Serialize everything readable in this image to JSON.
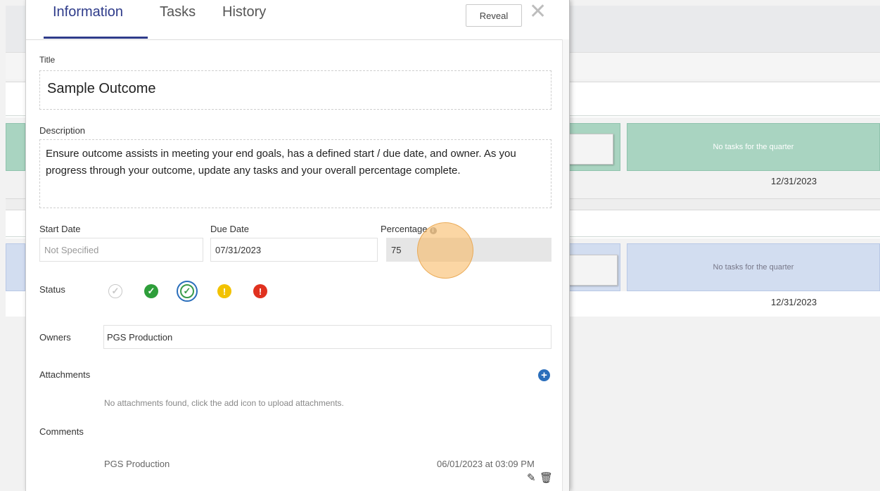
{
  "tabs": [
    {
      "label": "Information",
      "active": true
    },
    {
      "label": "Tasks",
      "active": false
    },
    {
      "label": "History",
      "active": false
    }
  ],
  "reveal_label": "Reveal",
  "title": {
    "label": "Title",
    "value": "Sample Outcome"
  },
  "description": {
    "label": "Description",
    "value": "Ensure outcome assists in meeting your end goals, has a defined start / due date, and owner. As you progress through your outcome, update any tasks and your overall percentage complete."
  },
  "start_date": {
    "label": "Start Date",
    "placeholder": "Not Specified"
  },
  "due_date": {
    "label": "Due Date",
    "value": "07/31/2023"
  },
  "percentage": {
    "label": "Percentage",
    "value": "75"
  },
  "status": {
    "label": "Status",
    "options": [
      "not-started",
      "on-track",
      "complete",
      "at-risk",
      "off-track"
    ],
    "selected": "complete",
    "colors": {
      "not-started": "#c8c8c8",
      "on-track": "#2e9e3a",
      "complete": "#3a9a4a",
      "at-risk": "#f2c200",
      "off-track": "#e0311f"
    }
  },
  "owners": {
    "label": "Owners",
    "value": "PGS Production"
  },
  "attachments": {
    "label": "Attachments",
    "empty_text": "No attachments found, click the add icon to upload attachments."
  },
  "comments": {
    "label": "Comments",
    "items": [
      {
        "author": "PGS Production",
        "timestamp": "06/01/2023 at 03:09 PM"
      }
    ]
  },
  "background": {
    "rows": [
      {
        "cell_text": "No tasks for the quarter",
        "date": "12/31/2023",
        "color": "#a9d4c1"
      },
      {
        "cell_text": "No tasks for the quarter",
        "date": "12/31/2023",
        "color": "#d2ddf0"
      }
    ]
  }
}
